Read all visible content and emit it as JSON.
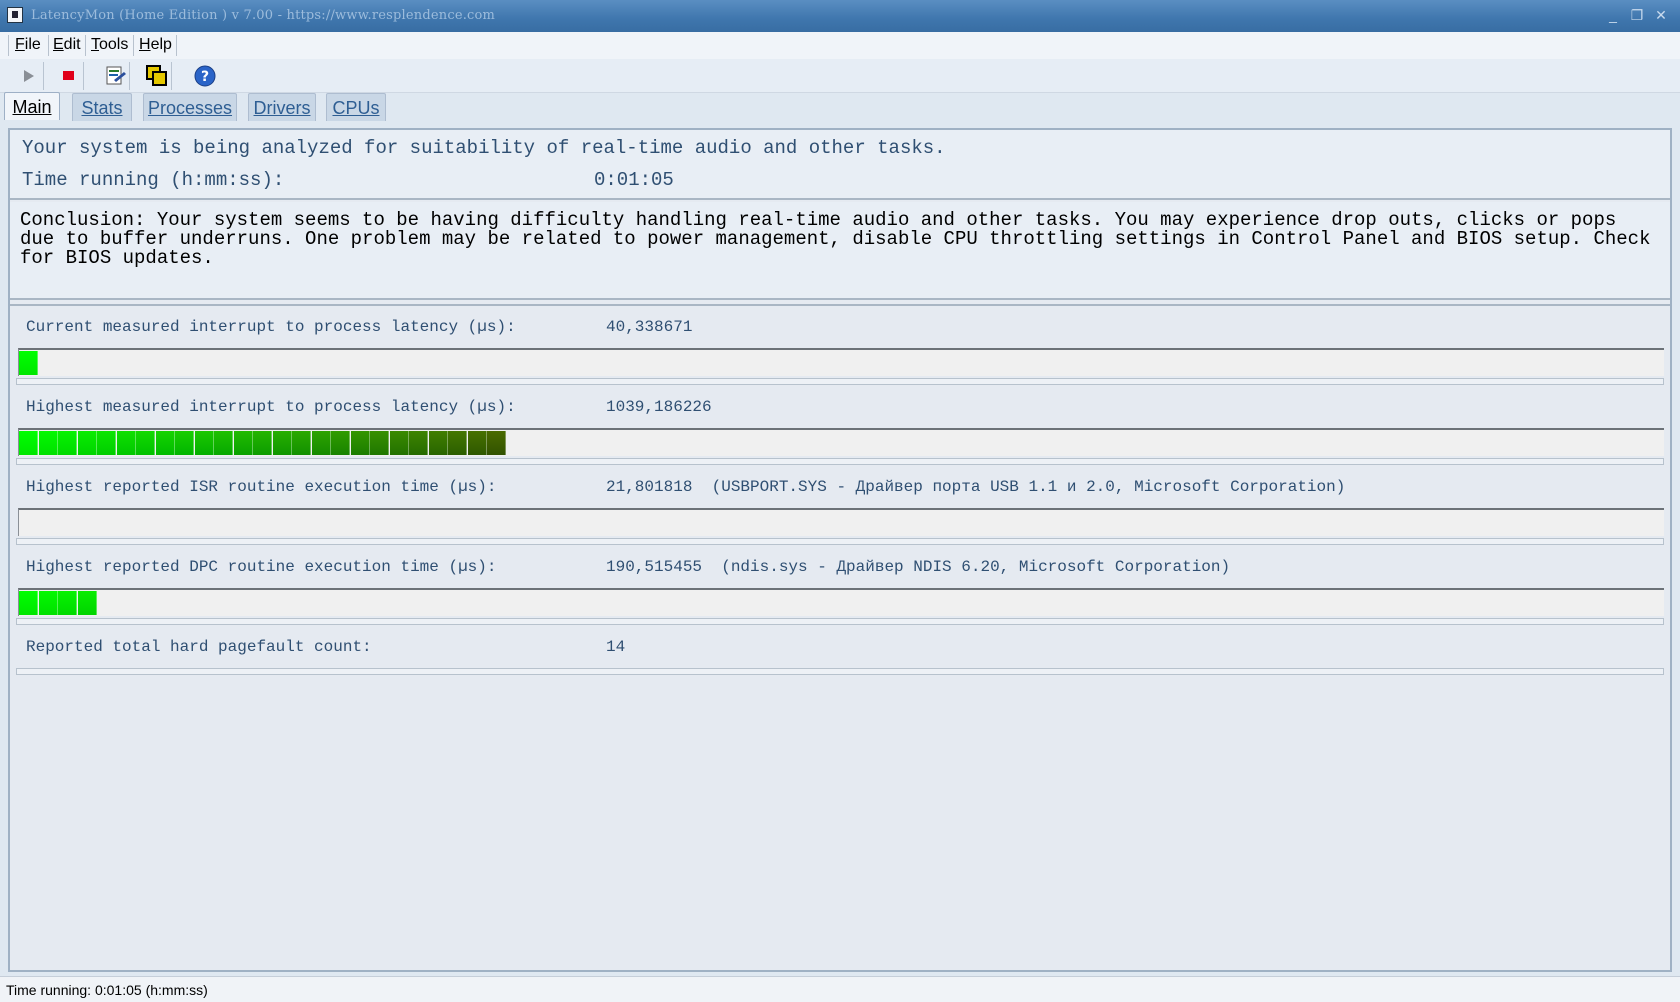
{
  "window": {
    "title": "LatencyMon  (Home Edition )  v 7.00 - https://www.resplendence.com"
  },
  "menu": [
    "File",
    "Edit",
    "Tools",
    "Help"
  ],
  "toolbar": {
    "icons": [
      "play-icon",
      "stop-icon",
      "report-icon",
      "copy-icon",
      "help-icon"
    ]
  },
  "tabs": [
    "Main",
    "Stats",
    "Processes",
    "Drivers",
    "CPUs"
  ],
  "main": {
    "analysis_text": "Your system is being analyzed for suitability of real-time audio and other tasks.",
    "time_label": "Time running (h:mm:ss):",
    "time_value": "0:01:05",
    "conclusion": "Conclusion: Your system seems to be having difficulty handling real-time audio and other tasks. You may experience drop outs, clicks or pops due to buffer underruns. One problem may be related to power management, disable CPU throttling settings in Control Panel and BIOS setup. Check for BIOS updates."
  },
  "metrics": [
    {
      "label": "Current measured interrupt to process latency (µs):",
      "value": "40,338671",
      "bar_segments": 1
    },
    {
      "label": "Highest measured interrupt to process latency (µs):",
      "value": "1039,186226",
      "bar_segments": 25
    },
    {
      "label": "Highest reported ISR routine execution time (µs):",
      "value": "21,801818  (USBPORT.SYS - Драйвер порта USB 1.1 и 2.0, Microsoft Corporation)",
      "bar_segments": 0
    },
    {
      "label": "Highest reported DPC routine execution time (µs):",
      "value": "190,515455  (ndis.sys - Драйвер NDIS 6.20, Microsoft Corporation)",
      "bar_segments": 4
    },
    {
      "label": "Reported total hard pagefault count:",
      "value": "14"
    }
  ],
  "statusbar": {
    "text": "Time running: 0:01:05  (h:mm:ss)"
  },
  "colors": {
    "bar_green_start": "#00ff00",
    "bar_green_end": "#4a6b00",
    "accent": "#3f76ad"
  }
}
